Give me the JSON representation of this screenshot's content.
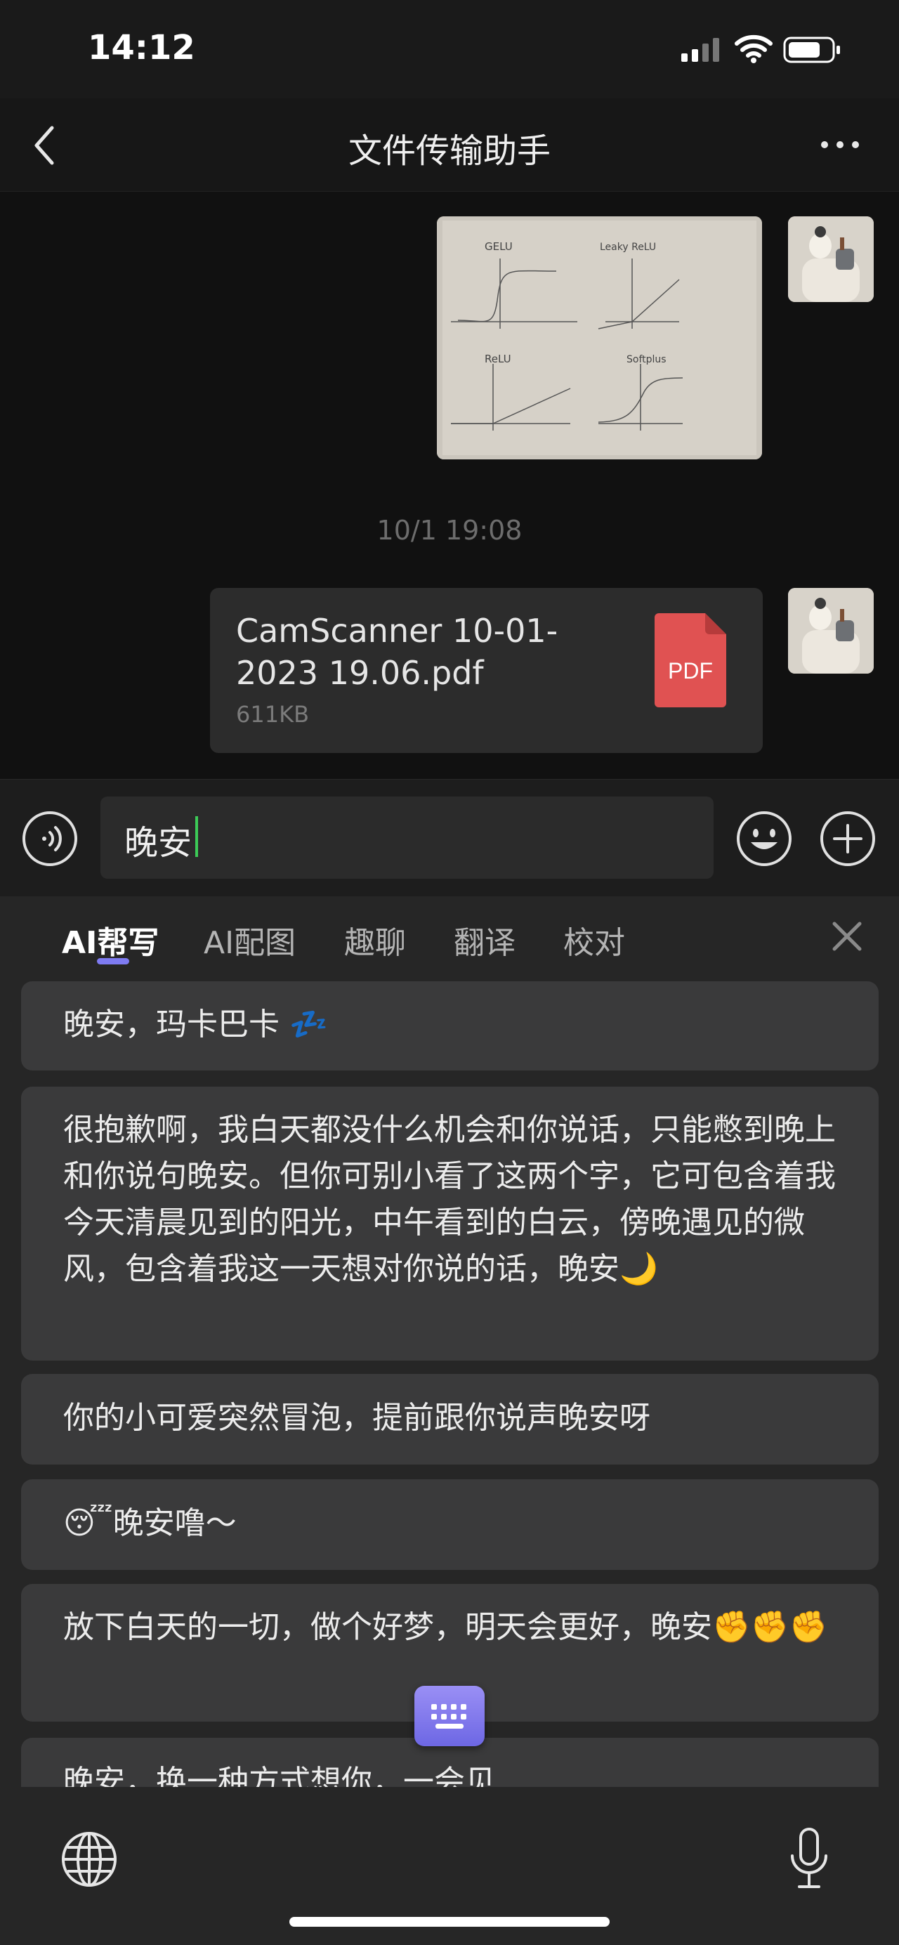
{
  "status_bar": {
    "time": "14:12"
  },
  "nav": {
    "title": "文件传输助手"
  },
  "chat": {
    "timestamp": "10/1 19:08",
    "image_message": {
      "plot_labels": [
        "GELU",
        "Leaky ReLU",
        "ReLU",
        "Softplus"
      ]
    },
    "file_message": {
      "name": "CamScanner 10-01-2023 19.06.pdf",
      "size": "611KB",
      "type_badge": "PDF"
    }
  },
  "input": {
    "value": "晚安"
  },
  "ai_panel": {
    "tabs": [
      "AI帮写",
      "AI配图",
      "趣聊",
      "翻译",
      "校对"
    ],
    "suggestions": [
      "晚安，玛卡巴卡 💤",
      "很抱歉啊，我白天都没什么机会和你说话，只能憋到晚上和你说句晚安。但你可别小看了这两个字，它可包含着我今天清晨见到的阳光，中午看到的白云，傍晚遇见的微风，包含着我这一天想对你说的话，晚安🌙",
      "你的小可爱突然冒泡，提前跟你说声晚安呀",
      "😴晚安噜～",
      "放下白天的一切，做个好梦，明天会更好，晚安✊✊✊",
      "晚安，换一种方式想你，一会见"
    ]
  },
  "colors": {
    "accent_purple": "#7e7bf2",
    "caret_green": "#3ccb57",
    "pdf_red": "#e05252"
  }
}
